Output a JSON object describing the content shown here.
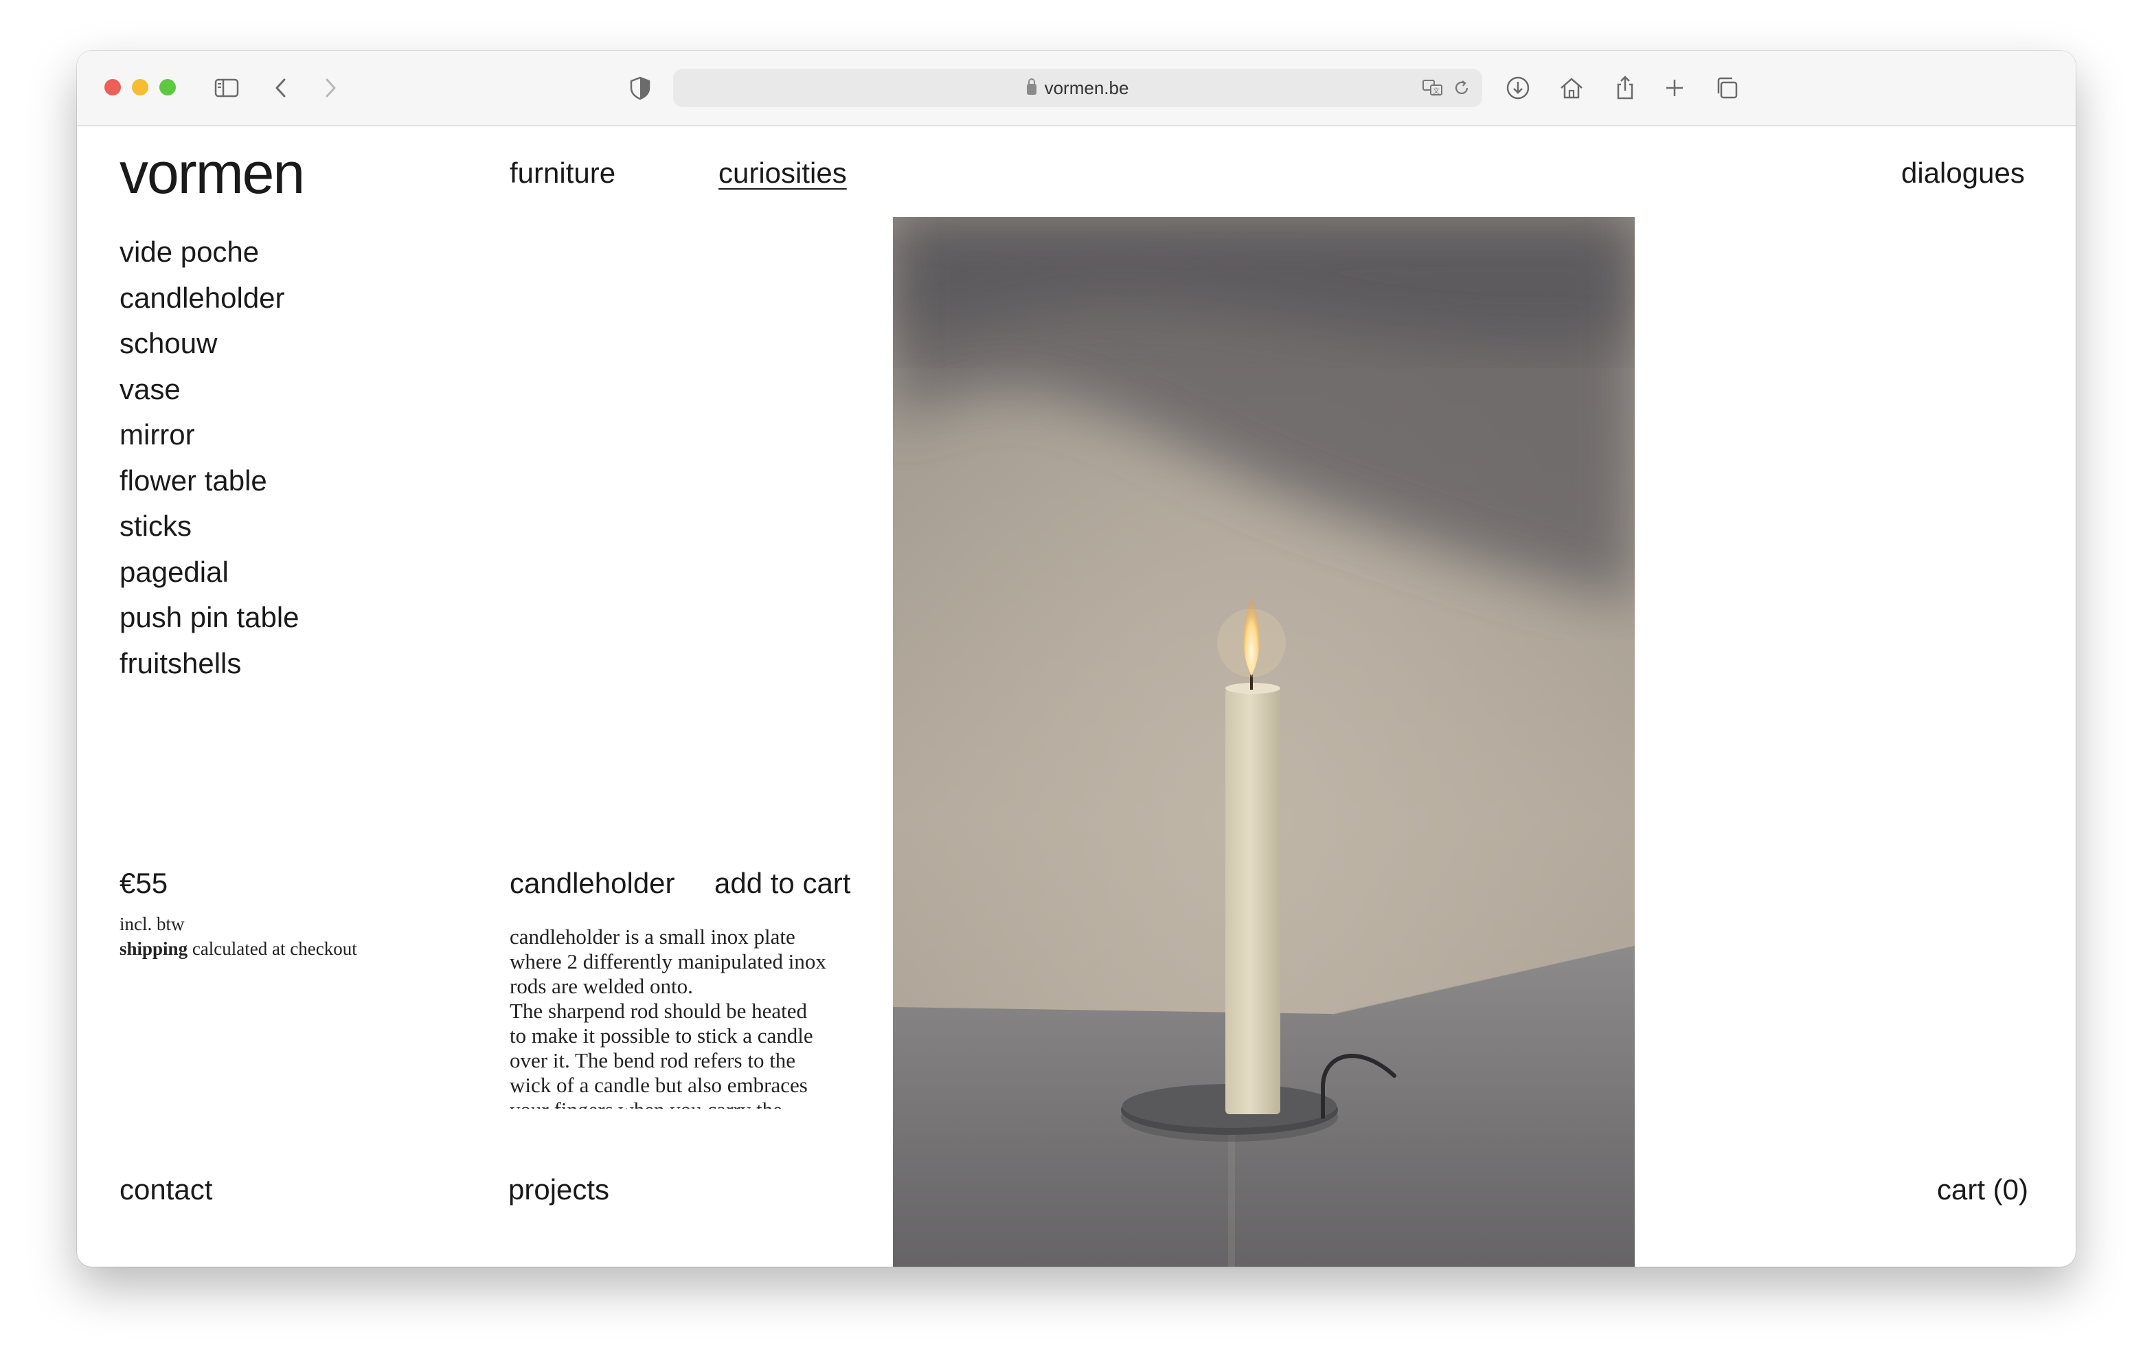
{
  "browser": {
    "url": "vormen.be",
    "icons": [
      "sidebar-icon",
      "back-icon",
      "forward-icon",
      "shield-icon",
      "lock-icon",
      "translate-icon",
      "reload-icon",
      "download-icon",
      "home-icon",
      "share-icon",
      "new-tab-icon",
      "tabs-overview-icon"
    ]
  },
  "site": {
    "logo": "vormen",
    "nav": {
      "furniture": "furniture",
      "curiosities": "curiosities",
      "dialogues": "dialogues"
    },
    "categories": [
      "vide poche",
      "candleholder",
      "schouw",
      "vase",
      "mirror",
      "flower table",
      "sticks",
      "pagedial",
      "push pin table",
      "fruitshells"
    ],
    "product": {
      "price": "€55",
      "tax_note": "incl. btw",
      "shipping_bold": "shipping",
      "shipping_rest": " calculated at checkout",
      "name": "candleholder",
      "add_to_cart": "add to cart",
      "description": "candleholder is a small inox plate\nwhere 2 differently manipulated inox\nrods are welded onto.\nThe sharpend rod should be heated\nto make it possible to stick a candle\nover it. The bend rod refers to the\nwick of a candle but also embraces\nyour fingers when you carry the"
    },
    "footer": {
      "contact": "contact",
      "projects": "projects",
      "cart": "cart (0)"
    }
  },
  "colors": {
    "text": "#1a1a1a",
    "photo_wall": "#a8a095",
    "photo_shadow": "#5e5c5f",
    "candle": "#ddd5bd",
    "plate": "#4a4a4c"
  }
}
